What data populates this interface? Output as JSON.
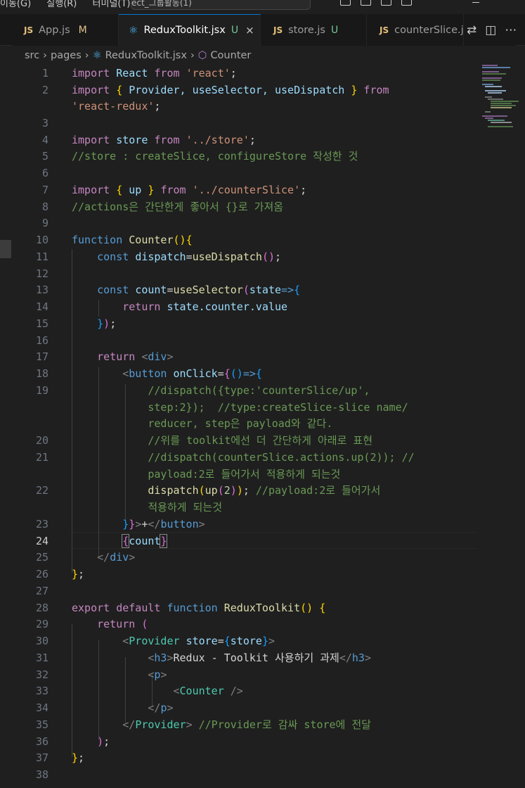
{
  "titlebar": {
    "menu": [
      "이동(G)",
      "실행(R)",
      "터미널(T)"
    ],
    "command_center": "ect_그룹활동(1)"
  },
  "tabs": [
    {
      "icon": "js-icon",
      "badge": "JS",
      "label": "App.js",
      "status": "M",
      "active": false
    },
    {
      "icon": "react-icon",
      "label": "ReduxToolkit.jsx",
      "status": "U",
      "active": true,
      "close": "×"
    },
    {
      "icon": "js-icon",
      "badge": "JS",
      "label": "store.js",
      "status": "U",
      "active": false
    },
    {
      "icon": "js-icon",
      "badge": "JS",
      "label": "counterSlice.js",
      "active": false
    }
  ],
  "breadcrumb": {
    "items": [
      "src",
      "pages",
      "ReduxToolkit.jsx",
      "Counter"
    ]
  },
  "editor": {
    "current_line": 24,
    "line_numbers": [
      "1",
      "2",
      "",
      "3",
      "4",
      "5",
      "6",
      "7",
      "8",
      "9",
      "10",
      "11",
      "12",
      "13",
      "14",
      "15",
      "16",
      "17",
      "18",
      "19",
      "",
      "",
      "20",
      "21",
      "",
      "22",
      "",
      "23",
      "24",
      "25",
      "26",
      "27",
      "28",
      "29",
      "30",
      "31",
      "32",
      "33",
      "34",
      "35",
      "36",
      "37",
      "38"
    ],
    "text": {
      "l1_import": "import",
      "l1_react": "React",
      "l1_from": "from",
      "l1_str": "'react'",
      "l1_semi": ";",
      "l2_import": "import",
      "l2_open": "{",
      "l2_names": " Provider, useSelector, useDispatch ",
      "l2_close": "}",
      "l2_from": "from",
      "l2b_str": "'react-redux'",
      "l2b_semi": ";",
      "l3_import": "import",
      "l3_store": "store",
      "l3_from": "from",
      "l3_str": "'../store'",
      "l3_semi": ";",
      "l4_comment": "//store : createSlice, configureStore 작성한 것",
      "l6_import": "import",
      "l6_open": "{",
      "l6_up": " up ",
      "l6_close": "}",
      "l6_from": "from",
      "l6_str": "'../counterSlice'",
      "l6_semi": ";",
      "l7_comment": "//actions은 간단한게 좋아서 {}로 가져옴",
      "l9_function": "function",
      "l9_name": "Counter",
      "l9_paren": "()",
      "l9_brace": "{",
      "l10_const": "const",
      "l10_var": "dispatch",
      "l10_eq": "=",
      "l10_fn": "useDispatch",
      "l10_paren": "()",
      "l10_semi": ";",
      "l12_const": "const",
      "l12_var": "count",
      "l12_eq": "=",
      "l12_fn": "useSelector",
      "l12_po": "(",
      "l12_param": "state",
      "l12_arrow": "=>",
      "l12_bo": "{",
      "l13_return": "return",
      "l13_expr": "state.counter.value",
      "l14_bc": "}",
      "l14_pc": ")",
      "l14_semi": ";",
      "l16_return": "return",
      "l16_lt": "<",
      "l16_tag": "div",
      "l16_gt": ">",
      "l17_lt": "<",
      "l17_tag": "button",
      "l17_attr": "onClick",
      "l17_eq": "=",
      "l17_bo": "{",
      "l17_p": "()",
      "l17_arrow": "=>",
      "l17_bo2": "{",
      "l18_c1": "//dispatch({type:'counterSlice/up',",
      "l18_c2": "step:2});  //type:createSlice-slice name/",
      "l18_c3": "reducer, step은 payload와 같다.",
      "l19_comment": "//위를 toolkit에선 더 간단하게 아래로 표현",
      "l20_c1": "//dispatch(counterSlice.actions.up(2)); //",
      "l20_c2": "payload:2로 들어가서 적용하게 되는것",
      "l21_fn": "dispatch",
      "l21_po": "(",
      "l21_up": "up",
      "l21_po2": "(",
      "l21_num": "2",
      "l21_pc2": ")",
      "l21_pc": ")",
      "l21_semi": ";",
      "l21_comment": "//payload:2로 들어가서",
      "l21b_comment": "적용하게 되는것",
      "l22_bc": "}",
      "l22_bc2": "}",
      "l22_gt": ">",
      "l22_text": "+",
      "l22_lt": "</",
      "l22_tag": "button",
      "l22_gt2": ">",
      "l23_bo": "{",
      "l23_var": "count",
      "l23_bc": "}",
      "l24_lt": "</",
      "l24_tag": "div",
      "l24_gt": ">",
      "l25_bc": "}",
      "l25_semi": ";",
      "l27_export": "export",
      "l27_default": "default",
      "l27_function": "function",
      "l27_name": "ReduxToolkit",
      "l27_paren": "()",
      "l27_brace": "{",
      "l28_return": "return",
      "l28_po": "(",
      "l29_lt": "<",
      "l29_tag": "Provider",
      "l29_attr": "store",
      "l29_eq": "=",
      "l29_bo": "{",
      "l29_val": "store",
      "l29_bc": "}",
      "l29_gt": ">",
      "l30_lt": "<",
      "l30_tag": "h3",
      "l30_gt": ">",
      "l30_text": "Redux - Toolkit 사용하기 과제",
      "l30_lt2": "</",
      "l30_tag2": "h3",
      "l30_gt2": ">",
      "l31_lt": "<",
      "l31_tag": "p",
      "l31_gt": ">",
      "l32_lt": "<",
      "l32_tag": "Counter",
      "l32_end": " />",
      "l33_lt": "</",
      "l33_tag": "p",
      "l33_gt": ">",
      "l34_lt": "</",
      "l34_tag": "Provider",
      "l34_gt": ">",
      "l34_comment": "//Provider로 감싸 store에 전달",
      "l35_pc": ")",
      "l35_semi": ";",
      "l36_bc": "}",
      "l36_semi": ";"
    }
  },
  "colors": {
    "editor_bg": "#1f1f1f",
    "keyword": "#569cd6",
    "control": "#c586c0",
    "string": "#ce9178",
    "comment": "#6a9955",
    "variable": "#9cdcfe",
    "function": "#dcdcaa",
    "component": "#4ec9b0",
    "accent": "#0078d4"
  }
}
